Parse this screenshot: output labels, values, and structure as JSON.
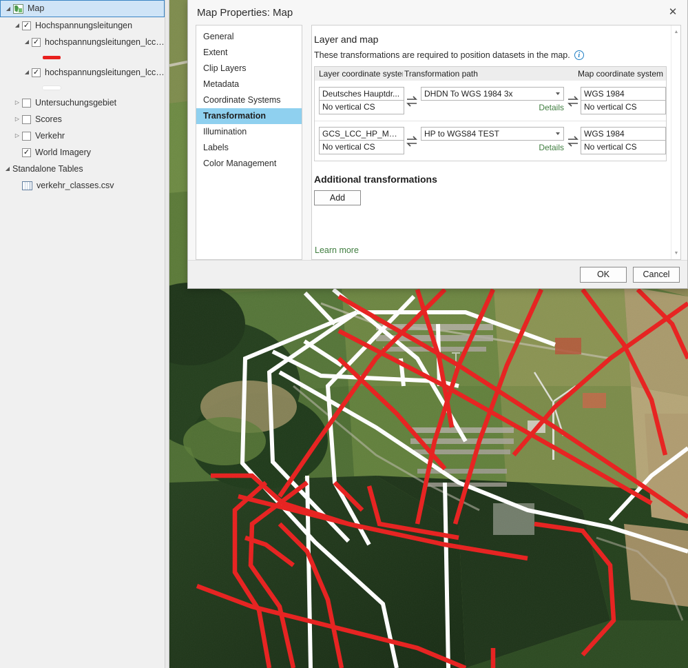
{
  "contents_pane": {
    "tree": [
      {
        "id": "map",
        "label": "Map",
        "icon": "map-icon",
        "indent": 0,
        "expander": "down",
        "checkbox": null,
        "selected": true
      },
      {
        "id": "hochspannungsleitungen-group",
        "label": "Hochspannungsleitungen",
        "icon": null,
        "indent": 1,
        "expander": "down",
        "checkbox": "checked",
        "selected": false
      },
      {
        "id": "hochspannungsleitungen-lcc-hp-1",
        "label": "hochspannungsleitungen_lcc_hp",
        "icon": null,
        "indent": 2,
        "expander": "down",
        "checkbox": "checked",
        "selected": false
      },
      {
        "id": "symbol-red",
        "label": "",
        "icon": null,
        "indent": 3,
        "expander": "none",
        "checkbox": null,
        "swatch": "#e8201e",
        "selected": false
      },
      {
        "id": "hochspannungsleitungen-lcc-hp-2",
        "label": "hochspannungsleitungen_lcc_hp",
        "icon": null,
        "indent": 2,
        "expander": "down",
        "checkbox": "checked",
        "selected": false
      },
      {
        "id": "symbol-white",
        "label": "",
        "icon": null,
        "indent": 3,
        "expander": "none",
        "checkbox": null,
        "swatch": "#ffffff",
        "selected": false
      },
      {
        "id": "untersuchungsgebiet",
        "label": "Untersuchungsgebiet",
        "icon": null,
        "indent": 1,
        "expander": "right",
        "checkbox": "unchecked",
        "selected": false
      },
      {
        "id": "scores",
        "label": "Scores",
        "icon": null,
        "indent": 1,
        "expander": "right",
        "checkbox": "unchecked",
        "selected": false
      },
      {
        "id": "verkehr",
        "label": "Verkehr",
        "icon": null,
        "indent": 1,
        "expander": "right",
        "checkbox": "unchecked",
        "selected": false
      },
      {
        "id": "world-imagery",
        "label": "World Imagery",
        "icon": null,
        "indent": 1,
        "expander": "none",
        "checkbox": "checked",
        "selected": false
      },
      {
        "id": "standalone-tables",
        "label": "Standalone Tables",
        "icon": null,
        "indent": 0,
        "expander": "down",
        "checkbox": null,
        "selected": false
      },
      {
        "id": "verkehr-classes-csv",
        "label": "verkehr_classes.csv",
        "icon": "table-icon",
        "indent": 1,
        "expander": "none",
        "checkbox": null,
        "selected": false
      }
    ]
  },
  "dialog": {
    "title": "Map Properties: Map",
    "close_label": "✕",
    "nav_items": [
      {
        "id": "general",
        "label": "General",
        "active": false
      },
      {
        "id": "extent",
        "label": "Extent",
        "active": false
      },
      {
        "id": "clip-layers",
        "label": "Clip Layers",
        "active": false
      },
      {
        "id": "metadata",
        "label": "Metadata",
        "active": false
      },
      {
        "id": "coordinate-systems",
        "label": "Coordinate Systems",
        "active": false
      },
      {
        "id": "transformation",
        "label": "Transformation",
        "active": true
      },
      {
        "id": "illumination",
        "label": "Illumination",
        "active": false
      },
      {
        "id": "labels",
        "label": "Labels",
        "active": false
      },
      {
        "id": "color-management",
        "label": "Color Management",
        "active": false
      }
    ],
    "section": {
      "title": "Layer and map",
      "description": "These transformations are required to position datasets in the map.",
      "info_icon": "info-icon"
    },
    "table": {
      "headers": {
        "layer_cs": "Layer coordinate system",
        "path": "Transformation path",
        "map_cs": "Map coordinate system"
      },
      "details_label": "Details",
      "rows": [
        {
          "layer_cs": "Deutsches Hauptdr...",
          "layer_vertical": "No vertical CS",
          "path": "DHDN To WGS 1984 3x",
          "map_cs": "WGS 1984",
          "map_vertical": "No vertical CS"
        },
        {
          "layer_cs": "GCS_LCC_HP_Matt...",
          "layer_vertical": "No vertical CS",
          "path": "HP to WGS84 TEST",
          "map_cs": "WGS 1984",
          "map_vertical": "No vertical CS"
        }
      ]
    },
    "additional": {
      "title": "Additional transformations",
      "add_label": "Add"
    },
    "learn_more_label": "Learn more",
    "footer": {
      "ok_label": "OK",
      "cancel_label": "Cancel"
    }
  },
  "map": {
    "line_colors": {
      "red": "#e8201e",
      "white": "#ffffff"
    }
  }
}
